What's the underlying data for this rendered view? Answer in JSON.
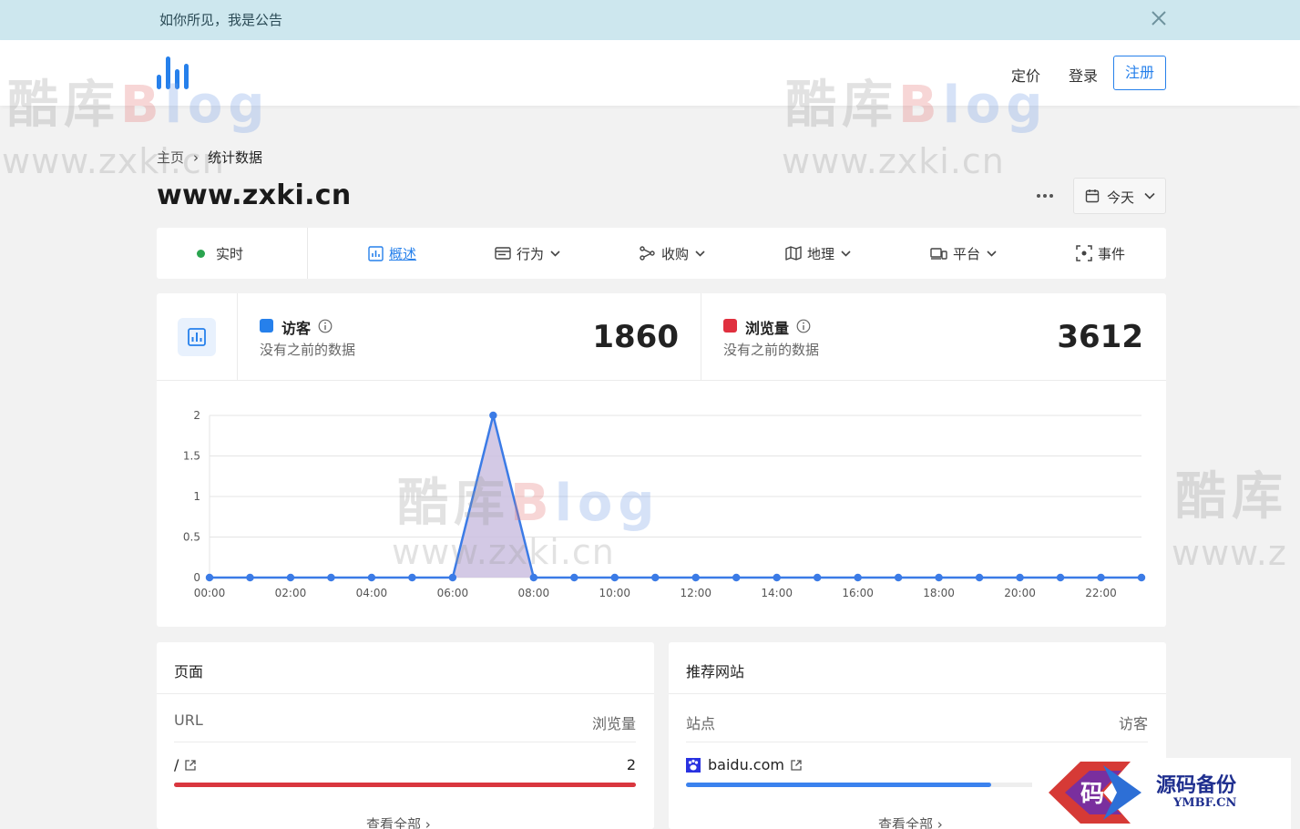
{
  "announcement": {
    "text": "如你所见，我是公告"
  },
  "nav": {
    "pricing": "定价",
    "login": "登录",
    "signup": "注册"
  },
  "breadcrumb": {
    "home": "主页",
    "current": "统计数据"
  },
  "site": {
    "title": "www.zxki.cn"
  },
  "date_range": {
    "label": "今天"
  },
  "tabs": [
    {
      "label": "实时",
      "icon": "status-dot"
    },
    {
      "label": "概述",
      "icon": "chart-icon",
      "active": true
    },
    {
      "label": "行为",
      "icon": "window-icon",
      "dropdown": true
    },
    {
      "label": "收购",
      "icon": "share-icon",
      "dropdown": true
    },
    {
      "label": "地理",
      "icon": "map-icon",
      "dropdown": true
    },
    {
      "label": "平台",
      "icon": "devices-icon",
      "dropdown": true
    },
    {
      "label": "事件",
      "icon": "focus-icon"
    }
  ],
  "metrics": {
    "visitors": {
      "name": "访客",
      "sub": "没有之前的数据",
      "value": "1860",
      "color": "#2680eb"
    },
    "pageviews": {
      "name": "浏览量",
      "sub": "没有之前的数据",
      "value": "3612",
      "color": "#e0303f"
    }
  },
  "chart_data": {
    "type": "line",
    "x": [
      "00:00",
      "01:00",
      "02:00",
      "03:00",
      "04:00",
      "05:00",
      "06:00",
      "07:00",
      "08:00",
      "09:00",
      "10:00",
      "11:00",
      "12:00",
      "13:00",
      "14:00",
      "15:00",
      "16:00",
      "17:00",
      "18:00",
      "19:00",
      "20:00",
      "21:00",
      "22:00",
      "23:00"
    ],
    "xticks": [
      "00:00",
      "02:00",
      "04:00",
      "06:00",
      "08:00",
      "10:00",
      "12:00",
      "14:00",
      "16:00",
      "18:00",
      "20:00",
      "22:00"
    ],
    "series": [
      {
        "values": [
          0,
          0,
          0,
          0,
          0,
          0,
          0,
          2,
          0,
          0,
          0,
          0,
          0,
          0,
          0,
          0,
          0,
          0,
          0,
          0,
          0,
          0,
          0,
          0
        ],
        "color": "#3b7be6",
        "fill": "#cbbfe0"
      }
    ],
    "yticks": [
      "0",
      "0.5",
      "1",
      "1.5",
      "2"
    ],
    "ylim": [
      0,
      2
    ],
    "grid": true
  },
  "pages_card": {
    "title": "页面",
    "col_left": "URL",
    "col_right": "浏览量",
    "rows": [
      {
        "label": "/",
        "value": "2",
        "fraction": 1.0,
        "color": "#d9363e"
      }
    ],
    "view_all": "查看全部"
  },
  "referrers_card": {
    "title": "推荐网站",
    "col_left": "站点",
    "col_right": "访客",
    "rows": [
      {
        "label": "baidu.com",
        "fraction": 0.66,
        "color": "#3b82ee"
      }
    ],
    "view_all": "查看全部"
  },
  "watermark": {
    "cn": "酷库Blog",
    "url": "www.zxki.cn"
  },
  "badge": {
    "glyph": "码",
    "title": "源码备份",
    "url": "YMBF.CN"
  }
}
